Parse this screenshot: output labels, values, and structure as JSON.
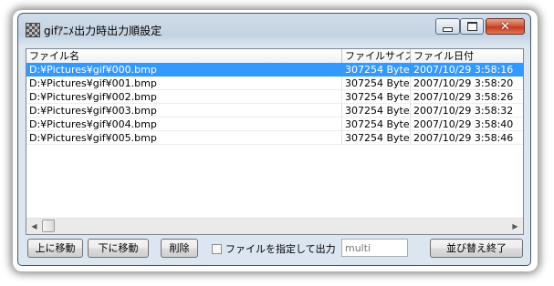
{
  "window": {
    "title": "gifｱﾆﾒ出力時出力順設定"
  },
  "titlebar_buttons": {
    "minimize": "—",
    "maximize": "□",
    "close": "✕"
  },
  "list": {
    "columns": [
      "ファイル名",
      "ファイルサイズ",
      "ファイル日付"
    ],
    "rows": [
      [
        "D:¥Pictures¥gif¥000.bmp",
        "307254 Byte",
        "2007/10/29 3:58:16"
      ],
      [
        "D:¥Pictures¥gif¥001.bmp",
        "307254 Byte",
        "2007/10/29 3:58:20"
      ],
      [
        "D:¥Pictures¥gif¥002.bmp",
        "307254 Byte",
        "2007/10/29 3:58:26"
      ],
      [
        "D:¥Pictures¥gif¥003.bmp",
        "307254 Byte",
        "2007/10/29 3:58:32"
      ],
      [
        "D:¥Pictures¥gif¥004.bmp",
        "307254 Byte",
        "2007/10/29 3:58:40"
      ],
      [
        "D:¥Pictures¥gif¥005.bmp",
        "307254 Byte",
        "2007/10/29 3:58:46"
      ]
    ],
    "selected_index": 0
  },
  "scrollbar": {
    "left_arrow": "◀",
    "right_arrow": "▶"
  },
  "buttons": {
    "move_up": "上に移動",
    "move_down": "下に移動",
    "delete": "削除",
    "finish": "並び替え終了"
  },
  "file_option": {
    "checkbox_label": "ファイルを指定して出力",
    "checked": false,
    "input_value": "multi"
  },
  "colors": {
    "selection": "#3399ff",
    "close_button": "#c63a1d"
  }
}
